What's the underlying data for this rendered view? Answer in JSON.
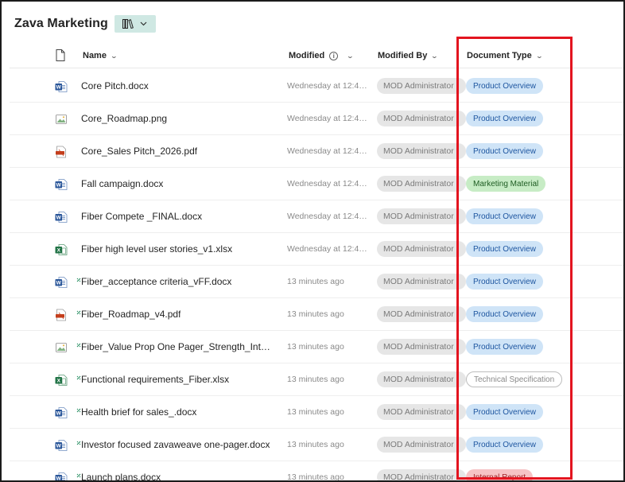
{
  "header": {
    "title": "Zava Marketing",
    "view_icon": "library-icon",
    "view_chevron": "chevron-down-icon"
  },
  "columns": {
    "name": "Name",
    "modified": "Modified",
    "modified_by": "Modified By",
    "document_type": "Document Type"
  },
  "rows": [
    {
      "name": "Core Pitch.docx",
      "icon": "word-icon",
      "new": false,
      "modified": "Wednesday at 12:4…",
      "modified_by": "MOD Administrator",
      "doc_type": "Product Overview",
      "tag_color": "blue"
    },
    {
      "name": "Core_Roadmap.png",
      "icon": "image-icon",
      "new": false,
      "modified": "Wednesday at 12:4…",
      "modified_by": "MOD Administrator",
      "doc_type": "Product Overview",
      "tag_color": "blue"
    },
    {
      "name": "Core_Sales Pitch_2026.pdf",
      "icon": "pdf-icon",
      "new": false,
      "modified": "Wednesday at 12:4…",
      "modified_by": "MOD Administrator",
      "doc_type": "Product Overview",
      "tag_color": "blue"
    },
    {
      "name": "Fall campaign.docx",
      "icon": "word-icon",
      "new": false,
      "modified": "Wednesday at 12:4…",
      "modified_by": "MOD Administrator",
      "doc_type": "Marketing Material",
      "tag_color": "green"
    },
    {
      "name": "Fiber Compete _FINAL.docx",
      "icon": "word-icon",
      "new": false,
      "modified": "Wednesday at 12:4…",
      "modified_by": "MOD Administrator",
      "doc_type": "Product Overview",
      "tag_color": "blue"
    },
    {
      "name": "Fiber high level user stories_v1.xlsx",
      "icon": "excel-icon",
      "new": false,
      "modified": "Wednesday at 12:4…",
      "modified_by": "MOD Administrator",
      "doc_type": "Product Overview",
      "tag_color": "blue"
    },
    {
      "name": "Fiber_acceptance criteria_vFF.docx",
      "icon": "word-icon",
      "new": true,
      "modified": "13 minutes ago",
      "modified_by": "MOD Administrator",
      "doc_type": "Product Overview",
      "tag_color": "blue"
    },
    {
      "name": "Fiber_Roadmap_v4.pdf",
      "icon": "pdf-icon",
      "new": true,
      "modified": "13 minutes ago",
      "modified_by": "MOD Administrator",
      "doc_type": "Product Overview",
      "tag_color": "blue"
    },
    {
      "name": "Fiber_Value Prop One Pager_Strength_Intel...",
      "icon": "image-icon",
      "new": true,
      "modified": "13 minutes ago",
      "modified_by": "MOD Administrator",
      "doc_type": "Product Overview",
      "tag_color": "blue"
    },
    {
      "name": "Functional requirements_Fiber.xlsx",
      "icon": "excel-icon",
      "new": true,
      "modified": "13 minutes ago",
      "modified_by": "MOD Administrator",
      "doc_type": "Technical Specification",
      "tag_color": "outline"
    },
    {
      "name": "Health brief for sales_.docx",
      "icon": "word-icon",
      "new": true,
      "modified": "13 minutes ago",
      "modified_by": "MOD Administrator",
      "doc_type": "Product Overview",
      "tag_color": "blue"
    },
    {
      "name": "Investor focused zavaweave one-pager.docx",
      "icon": "word-icon",
      "new": true,
      "modified": "13 minutes ago",
      "modified_by": "MOD Administrator",
      "doc_type": "Product Overview",
      "tag_color": "blue"
    },
    {
      "name": "Launch plans.docx",
      "icon": "word-icon",
      "new": true,
      "modified": "13 minutes ago",
      "modified_by": "MOD Administrator",
      "doc_type": "Internal Report",
      "tag_color": "red"
    }
  ],
  "colors": {
    "highlight": "#e3141f",
    "accent": "#cfe8e3",
    "word": "#2b579a",
    "excel": "#217346",
    "pdf": "#c43e1c"
  }
}
